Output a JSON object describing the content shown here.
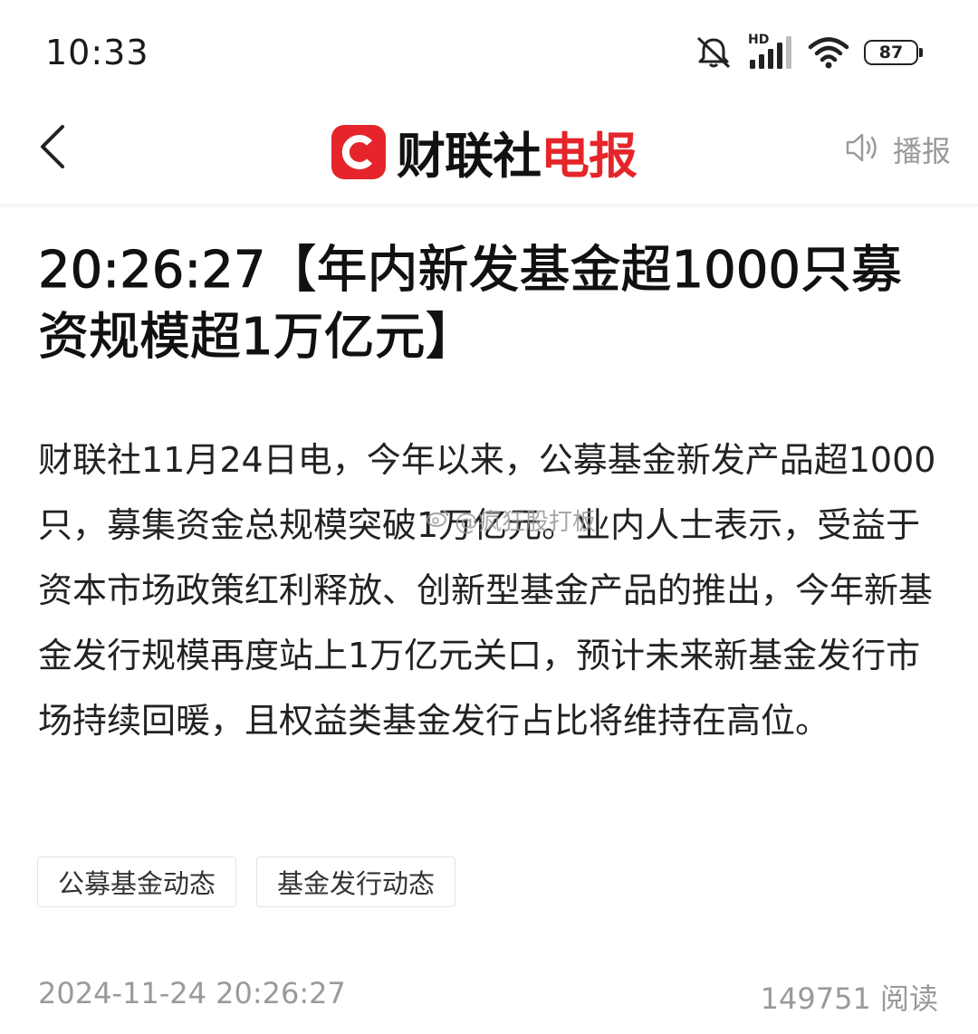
{
  "status_bar": {
    "time": "10:33",
    "network_label": "HD",
    "battery": "87",
    "icons": [
      "mute-icon",
      "signal-icon",
      "wifi-icon",
      "battery-icon"
    ]
  },
  "header": {
    "logo_letter": "C",
    "brand_name_black": "财联社",
    "brand_name_red": "电报",
    "broadcast_label": "播报",
    "brand_color": "#e5252a",
    "icons": [
      "back-arrow-icon",
      "speaker-icon"
    ]
  },
  "article": {
    "title": "20:26:27【年内新发基金超1000只募资规模超1万亿元】",
    "body": "财联社11月24日电，今年以来，公募基金新发产品超1000只，募集资金总规模突破1万亿元。业内人士表示，受益于资本市场政策红利释放、创新型基金产品的推出，今年新基金发行规模再度站上1万亿元关口，预计未来新基金发行市场持续回暖，且权益类基金发行占比将维持在高位。",
    "watermark": "@疯狂股打板",
    "tags": [
      "公募基金动态",
      "基金发行动态"
    ],
    "date": "2024-11-24 20:26:27",
    "reads": "149751 阅读"
  }
}
